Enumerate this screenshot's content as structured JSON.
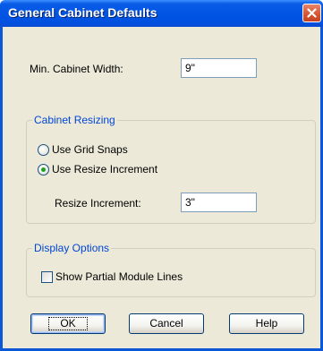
{
  "window": {
    "title": "General Cabinet Defaults"
  },
  "min_width": {
    "label": "Min. Cabinet Width:",
    "value": "9\""
  },
  "resizing": {
    "group_title": "Cabinet Resizing",
    "option_grid": "Use Grid Snaps",
    "option_increment": "Use Resize Increment",
    "selected": "Use Resize Increment",
    "increment_label": "Resize Increment:",
    "increment_value": "3\""
  },
  "display": {
    "group_title": "Display Options",
    "partial_lines_label": "Show Partial Module Lines",
    "partial_lines_checked": false
  },
  "buttons": {
    "ok": "OK",
    "cancel": "Cancel",
    "help": "Help"
  },
  "colors": {
    "titlebar": "#0054e3",
    "group_title": "#0046d5",
    "dialog_bg": "#ece9d8"
  }
}
